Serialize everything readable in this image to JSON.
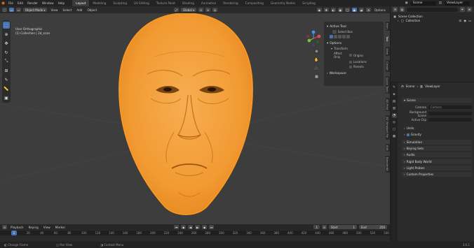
{
  "topbar": {
    "menus": [
      "File",
      "Edit",
      "Render",
      "Window",
      "Help"
    ],
    "workspaces": [
      "Layout",
      "Modeling",
      "Sculpting",
      "UV Editing",
      "Texture Paint",
      "Shading",
      "Animation",
      "Rendering",
      "Compositing",
      "Geometry Nodes",
      "Scripting"
    ],
    "active_workspace": "Layout",
    "scene": "Scene",
    "view_layer": "ViewLayer"
  },
  "viewport": {
    "mode": "Object Mode",
    "menus": [
      "View",
      "Select",
      "Add",
      "Object"
    ],
    "transform": "Global",
    "options": "Options",
    "info_line1": "User Orthographic",
    "info_line2": "(1) Collection | 3d_scan"
  },
  "npanel": {
    "active_tool": "Active Tool",
    "select_box": "Select Box",
    "options": "Options",
    "transform": "Transform",
    "affect_only": "Affect Only",
    "origins": "Origins",
    "locations": "Locations",
    "parents": "Parents",
    "workspace": "Workspace",
    "tabs": [
      "Item",
      "Tool",
      "View",
      "Create",
      "Quick Tools",
      "3D-Print",
      "3D Viewport Pie",
      "Edit",
      "BlenderKit"
    ]
  },
  "timeline": {
    "menus": [
      "Playback",
      "Keying",
      "View",
      "Marker"
    ],
    "current_frame": "1",
    "start_label": "Start",
    "start": "1",
    "end_label": "End",
    "end": "250",
    "ticks": [
      "1",
      "20",
      "40",
      "60",
      "80",
      "100",
      "120",
      "140",
      "160",
      "180",
      "200",
      "220",
      "240",
      "260",
      "280",
      "300",
      "320",
      "340",
      "360",
      "380",
      "400",
      "420",
      "440",
      "460",
      "480",
      "500",
      "520",
      "540"
    ]
  },
  "statusbar": {
    "items": [
      "Change Frame",
      "Pan View",
      "Context Menu"
    ],
    "version": "3.6.1"
  },
  "outliner": {
    "rows": [
      "Scene Collection",
      "Collection"
    ]
  },
  "properties": {
    "scene": "Scene",
    "view_layer": "ViewLayer",
    "scene_section": "Scene",
    "camera_label": "Camera",
    "camera_value": "Camera",
    "background_label": "Background Scene",
    "active_clip_label": "Active Clip",
    "units": "Units",
    "gravity": "Gravity",
    "sections": [
      "Simulation",
      "Keying Sets",
      "Audio",
      "Rigid Body World",
      "Light Probes",
      "Custom Properties"
    ]
  },
  "colors": {
    "accent": "#4772b3",
    "object_orange": "#f5a64a",
    "selection_outline": "#ff9a1f"
  }
}
